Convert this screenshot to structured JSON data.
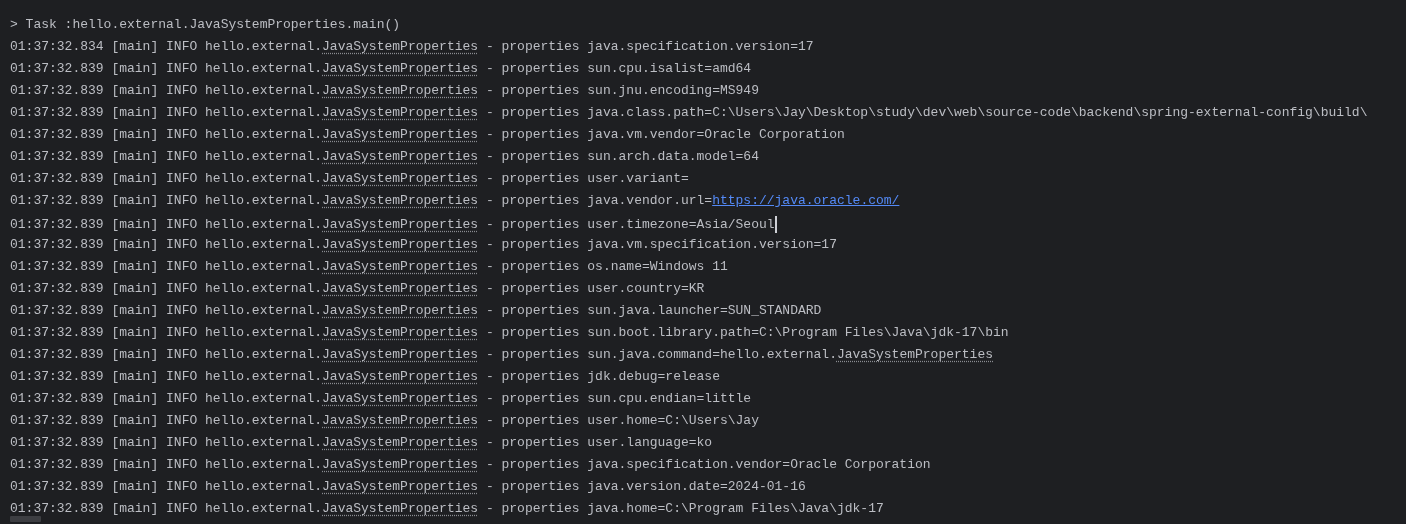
{
  "console": {
    "task_line": "> Task :hello.external.JavaSystemProperties.main()",
    "lines": [
      {
        "head": "01:37:32.834 [main] INFO hello.external.",
        "class": "JavaSystemProperties",
        "tail": "- properties java.specification.version=17"
      },
      {
        "head": "01:37:32.839 [main] INFO hello.external.",
        "class": "JavaSystemProperties",
        "tail": "- properties sun.cpu.isalist=amd64"
      },
      {
        "head": "01:37:32.839 [main] INFO hello.external.",
        "class": "JavaSystemProperties",
        "tail": "- properties sun.jnu.encoding=MS949"
      },
      {
        "head": "01:37:32.839 [main] INFO hello.external.",
        "class": "JavaSystemProperties",
        "tail": "- properties java.class.path=C:\\Users\\Jay\\Desktop\\study\\dev\\web\\source-code\\backend\\spring-external-config\\build\\"
      },
      {
        "head": "01:37:32.839 [main] INFO hello.external.",
        "class": "JavaSystemProperties",
        "tail": "- properties java.vm.vendor=Oracle Corporation"
      },
      {
        "head": "01:37:32.839 [main] INFO hello.external.",
        "class": "JavaSystemProperties",
        "tail": "- properties sun.arch.data.model=64"
      },
      {
        "head": "01:37:32.839 [main] INFO hello.external.",
        "class": "JavaSystemProperties",
        "tail": "- properties user.variant="
      },
      {
        "head": "01:37:32.839 [main] INFO hello.external.",
        "class": "JavaSystemProperties",
        "tail": "- properties java.vendor.url=",
        "link": "https://java.oracle.com/"
      },
      {
        "head": "01:37:32.839 [main] INFO hello.external.",
        "class": "JavaSystemProperties",
        "tail": "- properties user.timezone=Asia/Seoul",
        "caret": true
      },
      {
        "head": "01:37:32.839 [main] INFO hello.external.",
        "class": "JavaSystemProperties",
        "tail": "- properties java.vm.specification.version=17"
      },
      {
        "head": "01:37:32.839 [main] INFO hello.external.",
        "class": "JavaSystemProperties",
        "tail": "- properties os.name=Windows 11"
      },
      {
        "head": "01:37:32.839 [main] INFO hello.external.",
        "class": "JavaSystemProperties",
        "tail": "- properties user.country=KR"
      },
      {
        "head": "01:37:32.839 [main] INFO hello.external.",
        "class": "JavaSystemProperties",
        "tail": "- properties sun.java.launcher=SUN_STANDARD"
      },
      {
        "head": "01:37:32.839 [main] INFO hello.external.",
        "class": "JavaSystemProperties",
        "tail": "- properties sun.boot.library.path=C:\\Program Files\\Java\\jdk-17\\bin"
      },
      {
        "head": "01:37:32.839 [main] INFO hello.external.",
        "class": "JavaSystemProperties",
        "tail": "- properties sun.java.command=hello.external.",
        "tail_class": "JavaSystemProperties"
      },
      {
        "head": "01:37:32.839 [main] INFO hello.external.",
        "class": "JavaSystemProperties",
        "tail": "- properties jdk.debug=release"
      },
      {
        "head": "01:37:32.839 [main] INFO hello.external.",
        "class": "JavaSystemProperties",
        "tail": "- properties sun.cpu.endian=little"
      },
      {
        "head": "01:37:32.839 [main] INFO hello.external.",
        "class": "JavaSystemProperties",
        "tail": "- properties user.home=C:\\Users\\Jay"
      },
      {
        "head": "01:37:32.839 [main] INFO hello.external.",
        "class": "JavaSystemProperties",
        "tail": "- properties user.language=ko"
      },
      {
        "head": "01:37:32.839 [main] INFO hello.external.",
        "class": "JavaSystemProperties",
        "tail": "- properties java.specification.vendor=Oracle Corporation"
      },
      {
        "head": "01:37:32.839 [main] INFO hello.external.",
        "class": "JavaSystemProperties",
        "tail": "- properties java.version.date=2024-01-16"
      },
      {
        "head": "01:37:32.839 [main] INFO hello.external.",
        "class": "JavaSystemProperties",
        "tail": "- properties java.home=C:\\Program Files\\Java\\jdk-17"
      }
    ]
  }
}
